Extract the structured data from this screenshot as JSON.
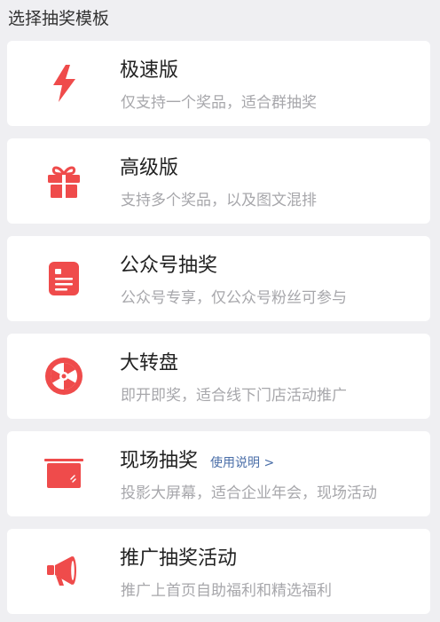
{
  "header": {
    "section_title": "选择抽奖模板"
  },
  "accent_color": "#ef4b4b",
  "templates": [
    {
      "icon": "lightning-icon",
      "title": "极速版",
      "desc": "仅支持一个奖品，适合群抽奖"
    },
    {
      "icon": "gift-icon",
      "title": "高级版",
      "desc": "支持多个奖品，以及图文混排"
    },
    {
      "icon": "document-icon",
      "title": "公众号抽奖",
      "desc": "公众号专享，仅公众号粉丝可参与"
    },
    {
      "icon": "wheel-icon",
      "title": "大转盘",
      "desc": "即开即奖，适合线下门店活动推广"
    },
    {
      "icon": "screen-icon",
      "title": "现场抽奖",
      "link": "使用说明 >",
      "desc": "投影大屏幕，适合企业年会，现场活动"
    },
    {
      "icon": "megaphone-icon",
      "title": "推广抽奖活动",
      "desc": "推广上首页自助福利和精选福利"
    }
  ]
}
